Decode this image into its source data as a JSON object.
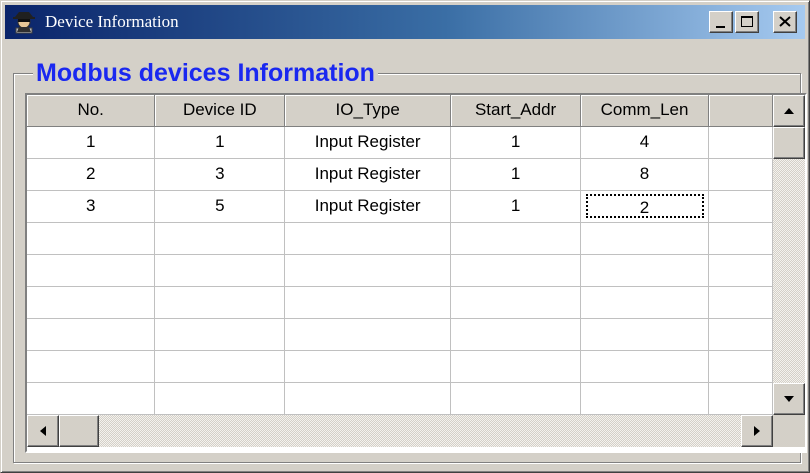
{
  "window": {
    "title": "Device Information",
    "icon": "device-spy-icon",
    "controls": [
      "minimize-icon",
      "maximize-icon",
      "close-icon"
    ]
  },
  "group": {
    "title": "Modbus devices Information",
    "title_color": "#1a28f0"
  },
  "grid": {
    "columns": [
      "No.",
      "Device ID",
      "IO_Type",
      "Start_Addr",
      "Comm_Len",
      ""
    ],
    "rows": [
      [
        "1",
        "1",
        "Input Register",
        "1",
        "4",
        ""
      ],
      [
        "2",
        "3",
        "Input Register",
        "1",
        "8",
        ""
      ],
      [
        "3",
        "5",
        "Input Register",
        "1",
        "2",
        ""
      ],
      [
        "",
        "",
        "",
        "",
        "",
        ""
      ],
      [
        "",
        "",
        "",
        "",
        "",
        ""
      ],
      [
        "",
        "",
        "",
        "",
        "",
        ""
      ],
      [
        "",
        "",
        "",
        "",
        "",
        ""
      ],
      [
        "",
        "",
        "",
        "",
        "",
        ""
      ],
      [
        "",
        "",
        "",
        "",
        "",
        ""
      ]
    ],
    "current_cell": {
      "row": 2,
      "col": 4
    }
  },
  "scrollbars": {
    "vertical": {
      "up": "arrow-up-icon",
      "down": "arrow-down-icon",
      "position": 0.0
    },
    "horizontal": {
      "left": "arrow-left-icon",
      "right": "arrow-right-icon",
      "position": 0.0
    }
  }
}
